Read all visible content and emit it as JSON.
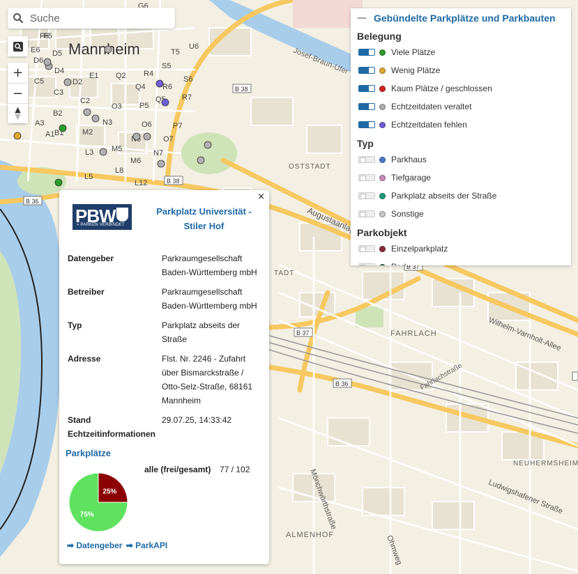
{
  "search": {
    "placeholder": "Suche"
  },
  "controls": {
    "zoom_in": "+",
    "zoom_out": "−",
    "compass": "▲"
  },
  "map": {
    "city_label": "Mannheim",
    "district_labels": [
      "OSTSTADT",
      "FAHRLACH",
      "NEUHERMSHEIM",
      "ALMENHOF",
      "TADT"
    ],
    "street_labels": [
      "Josef-Braun-Ufer",
      "Augustaanlage",
      "Wilhelm-Varnholt-Allee",
      "Fahrlachstraße",
      "Ludwigshafener Straße",
      "Mönchwörthstraße",
      "Ohmweg"
    ],
    "road_badges": [
      "B 38",
      "B 38",
      "B 36",
      "B 37",
      "B 37",
      "B 36"
    ],
    "square_labels": [
      "F6",
      "F5",
      "G6",
      "E6",
      "D6",
      "D5",
      "D4",
      "C5",
      "D2",
      "E1",
      "C3",
      "C2",
      "B2",
      "B1",
      "A3",
      "A1",
      "M2",
      "N3",
      "O3",
      "M5",
      "L3",
      "L8",
      "L5",
      "M6",
      "N7",
      "L12",
      "O6",
      "N6",
      "O7",
      "P7",
      "P5",
      "Q2",
      "Q4",
      "R4",
      "R6",
      "R7",
      "S5",
      "S6",
      "T5",
      "U6",
      "Q5"
    ]
  },
  "legend": {
    "title": "Gebündelte Parkplätze und Parkbauten",
    "collapse_symbol": "—",
    "sections": [
      {
        "heading": "Belegung",
        "items": [
          {
            "label": "Viele Plätze",
            "color": "#2a9d2a",
            "on": true
          },
          {
            "label": "Wenig Plätze",
            "color": "#e0a82e",
            "on": true
          },
          {
            "label": "Kaum Plätze / geschlossen",
            "color": "#d42020",
            "on": true
          },
          {
            "label": "Echtzeitdaten veraltet",
            "color": "#b0b0b0",
            "on": true
          },
          {
            "label": "Echtzeitdaten fehlen",
            "color": "#6f5fd6",
            "on": true
          }
        ]
      },
      {
        "heading": "Typ",
        "items": [
          {
            "label": "Parkhaus",
            "color": "#4a78c8",
            "on": false
          },
          {
            "label": "Tiefgarage",
            "color": "#c88ab8",
            "on": false
          },
          {
            "label": "Parkplatz abseits der Straße",
            "color": "#1a9a7a",
            "on": false
          },
          {
            "label": "Sonstige",
            "color": "#c8c8c8",
            "on": false
          }
        ]
      },
      {
        "heading": "Parkobjekt",
        "items": [
          {
            "label": "Einzelparkplatz",
            "color": "#8a2a3a",
            "on": false
          }
        ]
      }
    ],
    "partial_item": "Park"
  },
  "popup": {
    "close": "×",
    "logo": {
      "text": "PBW",
      "subtitle": "» PARKEN VERBINDET"
    },
    "title": "Parkplatz Universität - Stiler Hof",
    "rows": [
      {
        "key": "Datengeber",
        "value": "Parkraumgesellschaft Baden-Württemberg mbH"
      },
      {
        "key": "Betreiber",
        "value": "Parkraumgesellschaft Baden-Württemberg mbH"
      },
      {
        "key": "Typ",
        "value": "Parkplatz abseits der Straße"
      },
      {
        "key": "Adresse",
        "value": "Flst. Nr. 2246 - Zufahrt über Bismarckstraße / Otto-Selz-Straße, 68161 Mannheim"
      },
      {
        "key": "Stand Echtzeitinformationen",
        "value": "29.07.25, 14:33:42"
      }
    ],
    "parkplaetze_heading": "Parkplätze",
    "all_label": "alle (frei/gesamt)",
    "all_value": "77 / 102",
    "links": [
      "➡ Datengeber",
      "➡ ParkAPI"
    ]
  },
  "chart_data": {
    "type": "pie",
    "slices": [
      {
        "label": "25%",
        "value": 25,
        "color": "#8b0000"
      },
      {
        "label": "75%",
        "value": 75,
        "color": "#5fe35f"
      }
    ]
  }
}
